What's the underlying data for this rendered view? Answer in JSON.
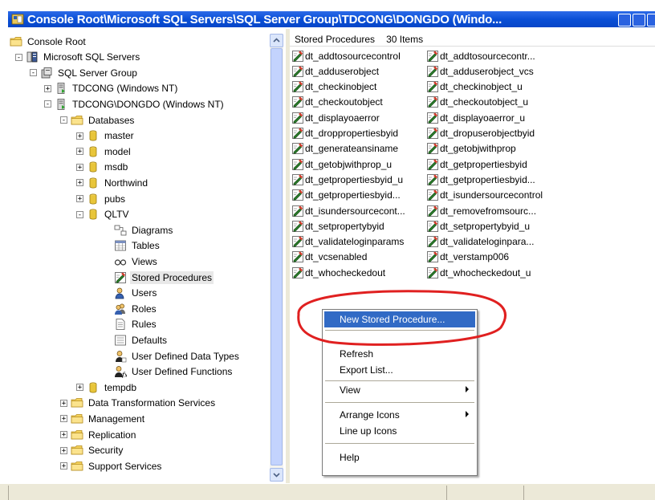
{
  "window": {
    "title": "Console Root\\Microsoft SQL Servers\\SQL Server Group\\TDCONG\\DONGDO (Windo..."
  },
  "tree": {
    "items": [
      {
        "label": "Console Root",
        "icon": "folder-icon"
      },
      {
        "label": "Microsoft SQL Servers",
        "icon": "sql-servers-icon"
      },
      {
        "label": "SQL Server Group",
        "icon": "server-group-icon"
      },
      {
        "label": "TDCONG (Windows NT)",
        "icon": "server-icon"
      },
      {
        "label": "TDCONG\\DONGDO (Windows NT)",
        "icon": "server-running-icon"
      },
      {
        "label": "Databases",
        "icon": "folder-icon"
      },
      {
        "label": "master",
        "icon": "database-icon"
      },
      {
        "label": "model",
        "icon": "database-icon"
      },
      {
        "label": "msdb",
        "icon": "database-icon"
      },
      {
        "label": "Northwind",
        "icon": "database-icon"
      },
      {
        "label": "pubs",
        "icon": "database-icon"
      },
      {
        "label": "QLTV",
        "icon": "database-icon"
      },
      {
        "label": "Diagrams",
        "icon": "diagram-icon"
      },
      {
        "label": "Tables",
        "icon": "table-icon"
      },
      {
        "label": "Views",
        "icon": "views-icon"
      },
      {
        "label": "Stored Procedures",
        "icon": "stored-procedure-icon"
      },
      {
        "label": "Users",
        "icon": "user-icon"
      },
      {
        "label": "Roles",
        "icon": "roles-icon"
      },
      {
        "label": "Rules",
        "icon": "rules-icon"
      },
      {
        "label": "Defaults",
        "icon": "defaults-icon"
      },
      {
        "label": "User Defined Data Types",
        "icon": "udt-icon"
      },
      {
        "label": "User Defined Functions",
        "icon": "udf-icon"
      },
      {
        "label": "tempdb",
        "icon": "database-icon"
      },
      {
        "label": "Data Transformation Services",
        "icon": "folder-icon"
      },
      {
        "label": "Management",
        "icon": "folder-icon"
      },
      {
        "label": "Replication",
        "icon": "folder-icon"
      },
      {
        "label": "Security",
        "icon": "folder-icon"
      },
      {
        "label": "Support Services",
        "icon": "folder-icon"
      }
    ]
  },
  "list": {
    "header": {
      "name": "Stored Procedures",
      "count": "30 Items"
    },
    "col1": [
      "dt_addtosourcecontrol",
      "dt_adduserobject",
      "dt_checkinobject",
      "dt_checkoutobject",
      "dt_displayoaerror",
      "dt_droppropertiesbyid",
      "dt_generateansiname",
      "dt_getobjwithprop_u",
      "dt_getpropertiesbyid_u",
      "dt_getpropertiesbyid...",
      "dt_isundersourcecont...",
      "dt_setpropertybyid",
      "dt_validateloginparams",
      "dt_vcsenabled",
      "dt_whocheckedout"
    ],
    "col2": [
      "dt_addtosourcecontr...",
      "dt_adduserobject_vcs",
      "dt_checkinobject_u",
      "dt_checkoutobject_u",
      "dt_displayoaerror_u",
      "dt_dropuserobjectbyid",
      "dt_getobjwithprop",
      "dt_getpropertiesbyid",
      "dt_getpropertiesbyid...",
      "dt_isundersourcecontrol",
      "dt_removefromsourc...",
      "dt_setpropertybyid_u",
      "dt_validateloginpara...",
      "dt_verstamp006",
      "dt_whocheckedout_u"
    ]
  },
  "context_menu": {
    "new_sp": "New Stored Procedure...",
    "refresh": "Refresh",
    "export": "Export List...",
    "view": "View",
    "arrange": "Arrange Icons",
    "lineup": "Line up Icons",
    "help": "Help"
  },
  "colors": {
    "titlebar": "#0a4fd6",
    "highlight": "#316ac5",
    "annotation": "#e02020"
  }
}
